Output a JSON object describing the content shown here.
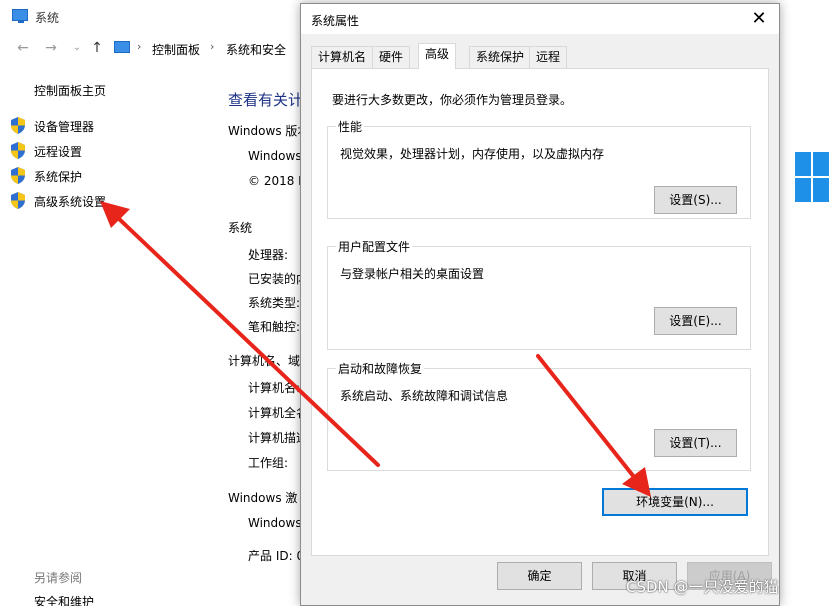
{
  "bg_window": {
    "title": "系统",
    "breadcrumb": [
      "控制面板",
      "系统和安全"
    ],
    "nav_home": "控制面板主页",
    "nav_items": [
      {
        "label": "设备管理器",
        "icon": "shield-icon"
      },
      {
        "label": "远程设置",
        "icon": "shield-icon"
      },
      {
        "label": "系统保护",
        "icon": "shield-icon"
      },
      {
        "label": "高级系统设置",
        "icon": "shield-icon"
      }
    ],
    "see_also": "另请参阅",
    "security_link": "安全和维护",
    "main": {
      "heading": "查看有关计",
      "lines": [
        "Windows 版本",
        "Windows",
        "© 2018 M",
        "系统",
        "处理器:",
        "已安装的内",
        "系统类型:",
        "笔和触控:",
        "计算机名、域",
        "计算机名:",
        "计算机全名",
        "计算机描述",
        "工作组:",
        "Windows 激",
        "Windows",
        "产品 ID: 0"
      ]
    }
  },
  "dialog": {
    "title": "系统属性",
    "close_glyph": "✕",
    "tabs": [
      "计算机名",
      "硬件",
      "高级",
      "系统保护",
      "远程"
    ],
    "active_tab": "高级",
    "admin_note": "要进行大多数更改，你必须作为管理员登录。",
    "groups": [
      {
        "title": "性能",
        "desc": "视觉效果，处理器计划，内存使用，以及虚拟内存",
        "button": "设置(S)..."
      },
      {
        "title": "用户配置文件",
        "desc": "与登录帐户相关的桌面设置",
        "button": "设置(E)..."
      },
      {
        "title": "启动和故障恢复",
        "desc": "系统启动、系统故障和调试信息",
        "button": "设置(T)..."
      }
    ],
    "env_button": "环境变量(N)...",
    "ok_button": "确定",
    "cancel_button": "取消",
    "apply_button": "应用(A)"
  },
  "watermark": "CSDN @一只没爱的猫",
  "colors": {
    "heading_blue": "#1e3287",
    "arrow_red": "#e8251b",
    "focus_blue": "#0078d7",
    "windows_blue": "#1e90e8"
  }
}
